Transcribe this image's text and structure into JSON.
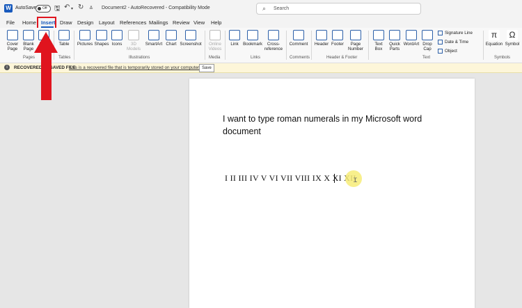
{
  "titlebar": {
    "app_icon": "W",
    "autosave_label": "AutoSave",
    "autosave_state": "Off",
    "document_title": "Document2  -  AutoRecovered  -  Compatibility Mode",
    "search_placeholder": "Search"
  },
  "tabs": [
    "File",
    "Home",
    "Insert",
    "Draw",
    "Design",
    "Layout",
    "References",
    "Mailings",
    "Review",
    "View",
    "Help"
  ],
  "active_tab": "Insert",
  "ribbon": {
    "pages": {
      "cover_page": "Cover Page",
      "blank_page": "Blank Page",
      "page_break": "Pa...",
      "group": "Pages"
    },
    "tables": {
      "table": "Table",
      "group": "Tables"
    },
    "illustrations": {
      "pictures": "Pictures",
      "shapes": "Shapes",
      "icons": "Icons",
      "models_3d": "3D Models",
      "smartart": "SmartArt",
      "chart": "Chart",
      "screenshot": "Screenshot",
      "group": "Illustrations"
    },
    "media": {
      "online_videos": "Online Videos",
      "group": "Media"
    },
    "links": {
      "link": "Link",
      "bookmark": "Bookmark",
      "cross_reference": "Cross-reference",
      "group": "Links"
    },
    "comments": {
      "comment": "Comment",
      "group": "Comments"
    },
    "header_footer": {
      "header": "Header",
      "footer": "Footer",
      "page_number": "Page Number",
      "group": "Header & Footer"
    },
    "text": {
      "text_box": "Text Box",
      "quick_parts": "Quick Parts",
      "wordart": "WordArt",
      "drop_cap": "Drop Cap",
      "signature_line": "Signature Line",
      "date_time": "Date & Time",
      "object": "Object",
      "group": "Text"
    },
    "symbols": {
      "equation": "Equation",
      "symbol": "Symbol",
      "group": "Symbols"
    }
  },
  "message_bar": {
    "title": "RECOVERED UNSAVED FILE",
    "text": "This is a recovered file that is temporarily stored on your computer.",
    "button": "Save"
  },
  "document": {
    "paragraph": "I want to type roman numerals in my Microsoft word document",
    "roman_line": "I  II  III IV  V  VI VII VIII IX  X  XI XII"
  },
  "colors": {
    "accent": "#185abd",
    "annotation": "#e0141e",
    "message_bar": "#fdf6d9"
  }
}
